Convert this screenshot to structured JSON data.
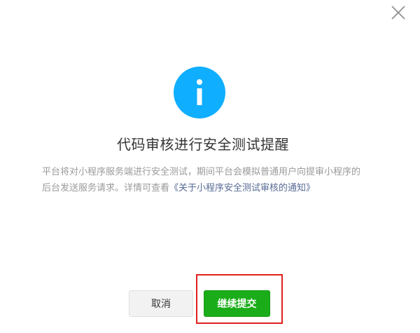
{
  "dialog": {
    "title": "代码审核进行安全测试提醒",
    "description_text": "平台将对小程序服务端进行安全测试，期间平台会模拟普通用户向提审小程序的后台发送服务请求。详情可查看",
    "link_text": "《关于小程序安全测试审核的通知》",
    "icon": "info-icon",
    "icon_color": "#10aeff"
  },
  "buttons": {
    "cancel_label": "取消",
    "submit_label": "继续提交"
  },
  "close_icon": "close-icon",
  "colors": {
    "submit_green": "#1aad19",
    "link_blue": "#576b95",
    "highlight_red": "#e02020"
  }
}
